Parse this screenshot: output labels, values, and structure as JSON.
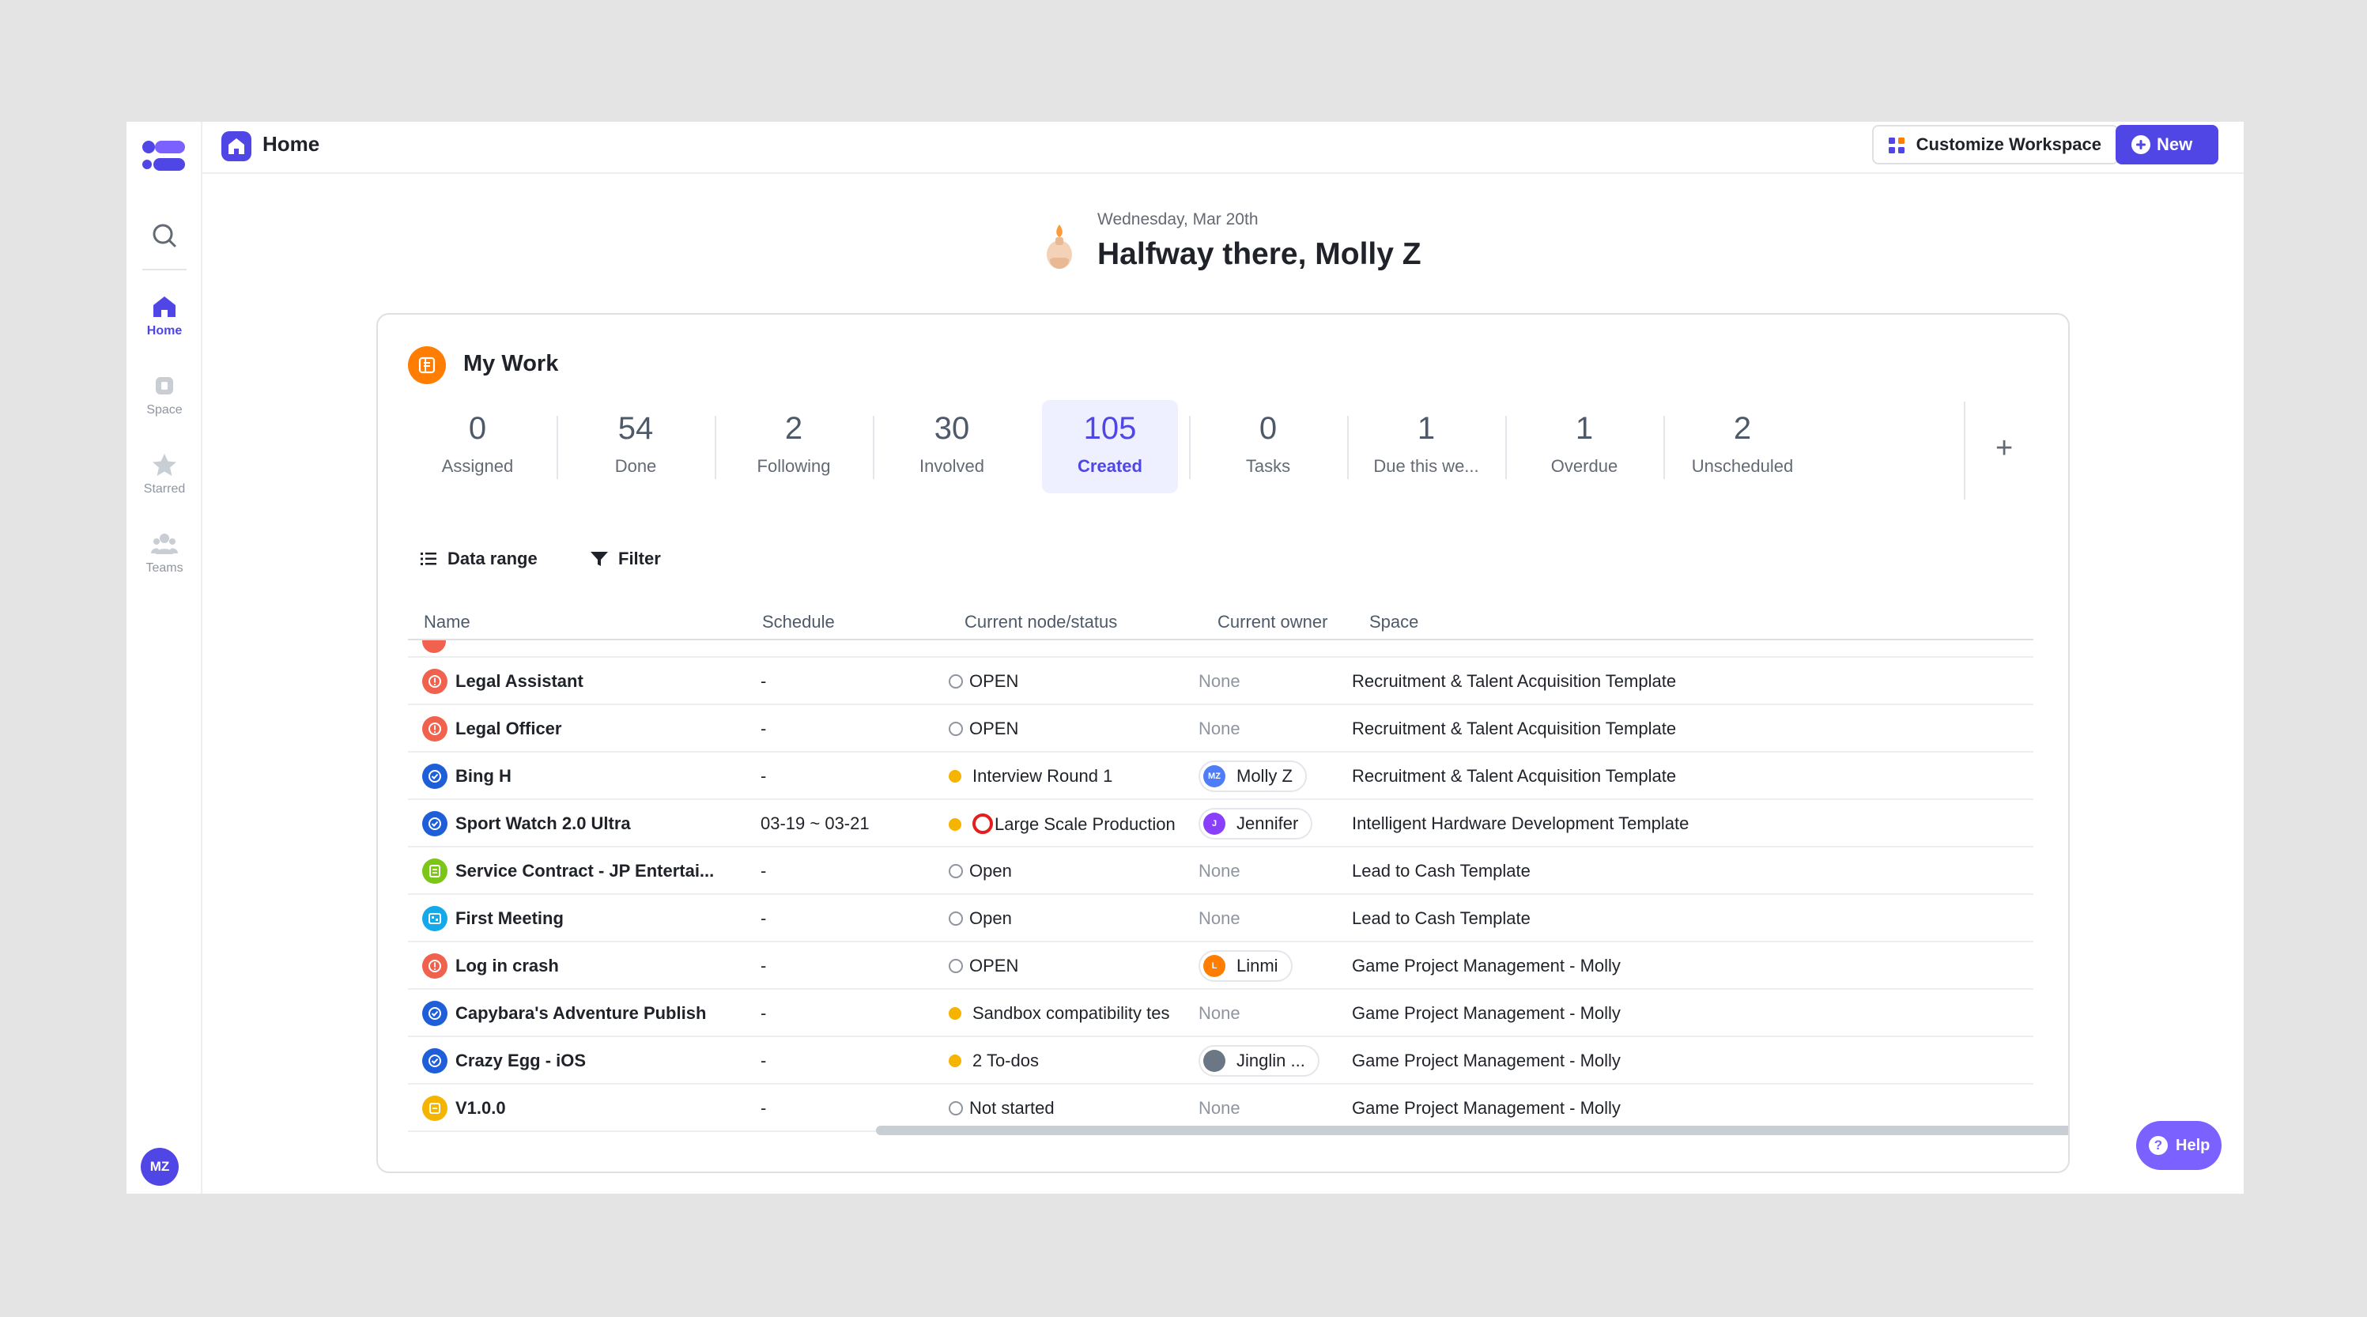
{
  "sidebar": {
    "items": [
      {
        "label": "Home",
        "icon": "home-icon"
      },
      {
        "label": "Space",
        "icon": "space-icon"
      },
      {
        "label": "Starred",
        "icon": "star-icon"
      },
      {
        "label": "Teams",
        "icon": "teams-icon"
      }
    ],
    "user_initials": "MZ"
  },
  "topbar": {
    "title": "Home",
    "customize_label": "Customize Workspace",
    "new_label": "New"
  },
  "greeting": {
    "date": "Wednesday, Mar 20th",
    "title": "Halfway there, Molly Z"
  },
  "my_work": {
    "title": "My Work",
    "stats": [
      {
        "value": "0",
        "label": "Assigned"
      },
      {
        "value": "54",
        "label": "Done"
      },
      {
        "value": "2",
        "label": "Following"
      },
      {
        "value": "30",
        "label": "Involved"
      },
      {
        "value": "105",
        "label": "Created"
      },
      {
        "value": "0",
        "label": "Tasks"
      },
      {
        "value": "1",
        "label": "Due this we..."
      },
      {
        "value": "1",
        "label": "Overdue"
      },
      {
        "value": "2",
        "label": "Unscheduled"
      }
    ],
    "active_stat": "Created",
    "add_label": "+",
    "toolbar": {
      "date_range": "Data range",
      "filter": "Filter"
    },
    "columns": {
      "name": "Name",
      "schedule": "Schedule",
      "status": "Current node/status",
      "owner": "Current owner",
      "space": "Space"
    },
    "rows": [
      {
        "name": "Legal Assistant",
        "schedule": "-",
        "status": "OPEN",
        "owner": "None",
        "space": "Recruitment & Talent Acquisition Template"
      },
      {
        "name": "Legal Officer",
        "schedule": "-",
        "status": "OPEN",
        "owner": "None",
        "space": "Recruitment & Talent Acquisition Template"
      },
      {
        "name": "Bing H",
        "schedule": "-",
        "status": "Interview Round 1",
        "owner": "Molly Z",
        "owner_initials": "MZ",
        "space": "Recruitment & Talent Acquisition Template"
      },
      {
        "name": "Sport Watch 2.0 Ultra",
        "schedule": "03-19 ~ 03-21",
        "status": "Large Scale Production",
        "owner": "Jennifer",
        "owner_initials": "J",
        "space": "Intelligent Hardware Development Template"
      },
      {
        "name": "Service Contract - JP Entertai...",
        "schedule": "-",
        "status": "Open",
        "owner": "None",
        "space": "Lead to Cash Template"
      },
      {
        "name": "First Meeting",
        "schedule": "-",
        "status": "Open",
        "owner": "None",
        "space": "Lead to Cash Template"
      },
      {
        "name": "Log in crash",
        "schedule": "-",
        "status": "OPEN",
        "owner": "Linmi",
        "owner_initials": "L",
        "space": "Game Project Management - Molly"
      },
      {
        "name": "Capybara's Adventure Publish",
        "schedule": "-",
        "status": "Sandbox compatibility tes",
        "owner": "None",
        "space": "Game Project Management - Molly"
      },
      {
        "name": "Crazy Egg - iOS",
        "schedule": "-",
        "status": "2 To-dos",
        "owner": "Jinglin ...",
        "space": "Game Project Management - Molly"
      },
      {
        "name": "V1.0.0",
        "schedule": "-",
        "status": "Not started",
        "owner": "None",
        "space": "Game Project Management - Molly"
      }
    ]
  },
  "help_label": "Help",
  "colors": {
    "accent": "#4f46e5",
    "help": "#7b61ff",
    "status_pending": "#f5b400",
    "status_alert": "#e51d1d",
    "mywork_icon": "#ff7d00"
  }
}
